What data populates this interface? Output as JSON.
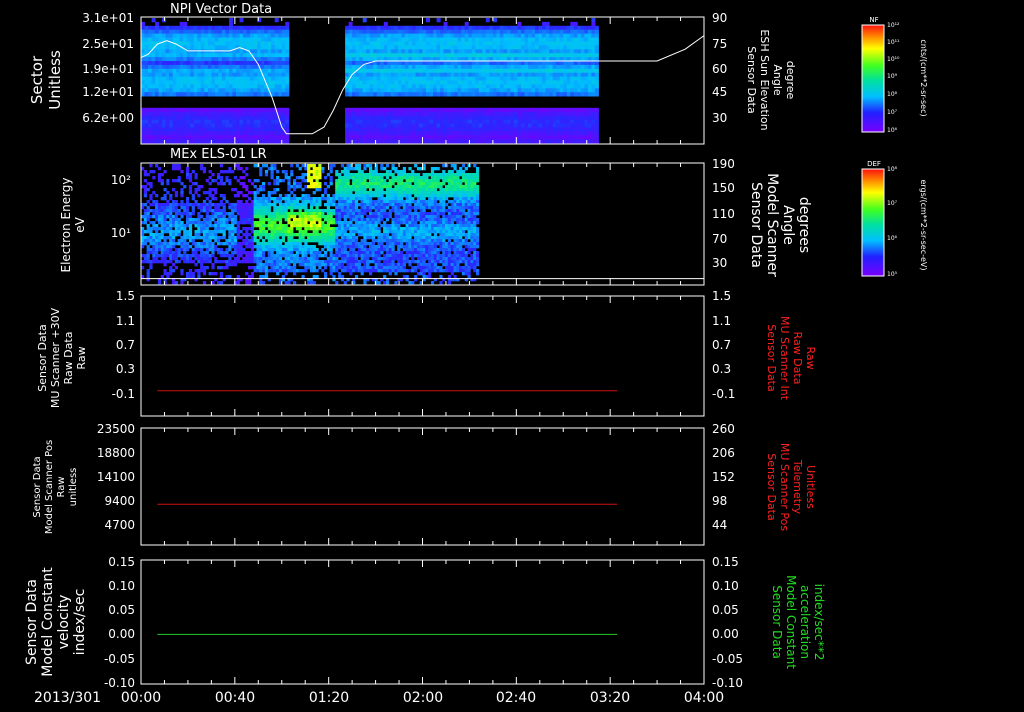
{
  "figure": {
    "date_label": "2013/301",
    "time_ticks": [
      "00:00",
      "00:40",
      "01:20",
      "02:00",
      "02:40",
      "03:20",
      "04:00"
    ],
    "time_range_min": [
      0,
      240
    ]
  },
  "chart_data": [
    {
      "type": "heatmap",
      "title": "NPI Vector Data",
      "ylabel": [
        "Sector",
        "Unitless"
      ],
      "yticks": [
        "3.1e+01",
        "2.5e+01",
        "1.9e+01",
        "1.2e+01",
        "6.2e+00"
      ],
      "ylabel_right": [
        "Sensor Data",
        "ESH Sun Elevation",
        "Angle",
        "degree"
      ],
      "yticks_right": [
        "90",
        "75",
        "60",
        "45",
        "30"
      ],
      "ylim_right": [
        15,
        90
      ],
      "data_gap_min": [
        [
          62,
          86
        ]
      ],
      "data_coverage_min": [
        0,
        195
      ],
      "overlay_line": {
        "name": "ESH Sun Elevation Angle",
        "color": "#ffffff",
        "points": [
          [
            0,
            66
          ],
          [
            3,
            68
          ],
          [
            7,
            74
          ],
          [
            11,
            76
          ],
          [
            15,
            74
          ],
          [
            20,
            70
          ],
          [
            30,
            70
          ],
          [
            38,
            70
          ],
          [
            42,
            72
          ],
          [
            46,
            70
          ],
          [
            50,
            62
          ],
          [
            56,
            42
          ],
          [
            60,
            25
          ],
          [
            62,
            21
          ],
          [
            68,
            21
          ],
          [
            73,
            21
          ],
          [
            78,
            25
          ],
          [
            82,
            35
          ],
          [
            86,
            47
          ],
          [
            90,
            56
          ],
          [
            95,
            62
          ],
          [
            100,
            64
          ],
          [
            130,
            64
          ],
          [
            220,
            64
          ],
          [
            232,
            71
          ],
          [
            240,
            79
          ]
        ]
      },
      "colorbar": {
        "label": "NF",
        "tick_labels": [
          "10¹²",
          "10¹¹",
          "10¹⁰",
          "10⁹",
          "10⁸",
          "10⁷",
          "10⁶"
        ],
        "units": "cnts/(cm**2-sr-sec)"
      }
    },
    {
      "type": "heatmap",
      "title": "MEx ELS-01 LR",
      "ylabel": [
        "Electron Energy",
        "eV"
      ],
      "yticks": [
        "10²",
        "10¹"
      ],
      "ylabel_right": [
        "Sensor Data",
        "Model Scanner",
        "Angle",
        "degrees"
      ],
      "yticks_right": [
        "190",
        "150",
        "110",
        "70",
        "30"
      ],
      "ylim_right": [
        0,
        190
      ],
      "data_coverage_min": [
        0,
        143
      ],
      "overlay_line": {
        "name": "Model Scanner Angle",
        "color": "#ffffff",
        "points": [
          [
            0,
            10
          ],
          [
            240,
            10
          ]
        ]
      },
      "colorbar": {
        "label": "DEF",
        "tick_labels": [
          "10⁸",
          "10⁷",
          "10⁶",
          "10⁵"
        ],
        "units": "ergs/(cm**2-sr-sec-eV)"
      }
    },
    {
      "type": "line",
      "ylabel": [
        "Sensor Data",
        "MU Scanner +30V",
        "Raw Data",
        "Raw"
      ],
      "yticks": [
        "1.5",
        "1.1",
        "0.7",
        "0.3",
        "-0.1"
      ],
      "ylim": [
        -0.4,
        1.5
      ],
      "ylabel_right": [
        "Sensor Data",
        "MU Scanner Int",
        "Raw Data",
        "Raw"
      ],
      "yticks_right": [
        "1.5",
        "1.1",
        "0.7",
        "0.3",
        "-0.1"
      ],
      "series": [
        {
          "color": "#cc1111",
          "x": [
            7,
            203
          ],
          "y": [
            0.0,
            0.0
          ]
        }
      ]
    },
    {
      "type": "line",
      "ylabel": [
        "Sensor Data",
        "Model Scanner Pos",
        "Raw",
        "unitless"
      ],
      "yticks": [
        "23500",
        "18800",
        "14100",
        "9400",
        "4700"
      ],
      "ylim": [
        0,
        23500
      ],
      "ylabel_right": [
        "Sensor Data",
        "MU Scanner Pos",
        "Telemetry",
        "Unitless"
      ],
      "yticks_right": [
        "260",
        "206",
        "152",
        "98",
        "44"
      ],
      "series": [
        {
          "color": "#cc1111",
          "x": [
            7,
            203
          ],
          "y": [
            8200,
            8200
          ]
        }
      ]
    },
    {
      "type": "line",
      "ylabel": [
        "Sensor Data",
        "Model Constant",
        "velocity",
        "index/sec"
      ],
      "yticks": [
        "0.15",
        "0.10",
        "0.05",
        "0.00",
        "-0.05",
        "-0.10"
      ],
      "ylim": [
        -0.1,
        0.15
      ],
      "ylabel_right": [
        "Sensor Data",
        "Model Constant",
        "acceleration",
        "index/sec**2"
      ],
      "yticks_right": [
        "0.15",
        "0.10",
        "0.05",
        "0.00",
        "-0.05",
        "-0.10"
      ],
      "series": [
        {
          "color": "#22cc22",
          "x": [
            7,
            203
          ],
          "y": [
            0.0,
            0.0
          ]
        }
      ]
    }
  ],
  "colors": {
    "axis": "#ffffff",
    "right_label_red": "#ff2020",
    "right_label_green": "#22dd22",
    "right_label_white": "#ffffff"
  }
}
